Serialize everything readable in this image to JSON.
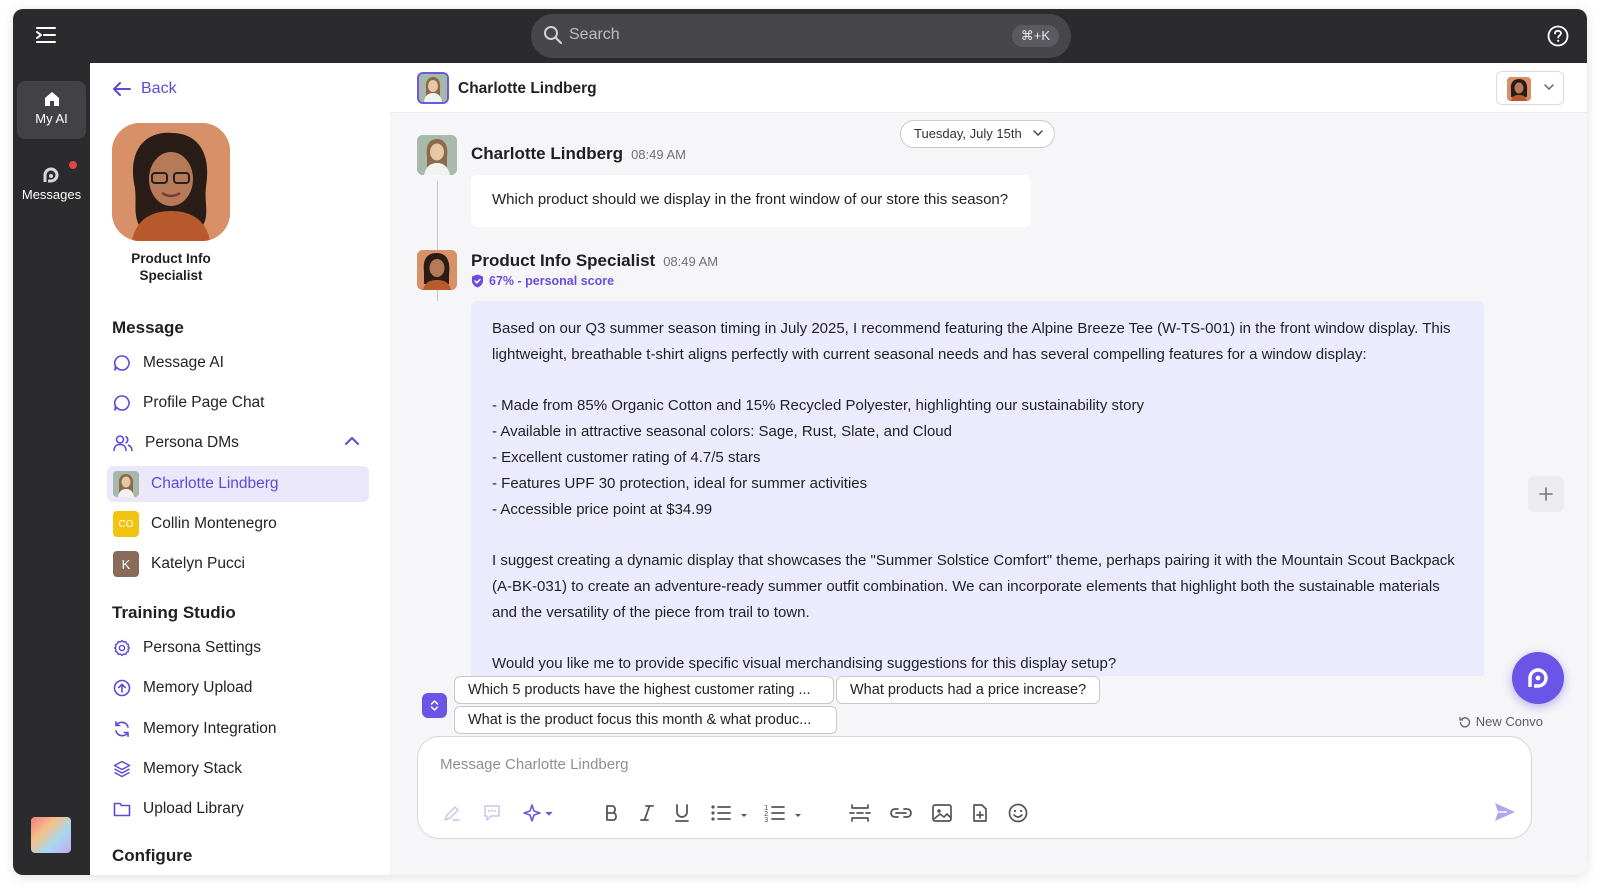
{
  "topbar": {
    "search_placeholder": "Search",
    "search_shortcut": "⌘+K"
  },
  "rail": {
    "items": [
      {
        "label": "My AI",
        "icon": "home-icon",
        "active": true
      },
      {
        "label": "Messages",
        "icon": "messages-icon",
        "has_notification": true
      }
    ]
  },
  "sidebar": {
    "back_label": "Back",
    "persona_name": "Product Info Specialist",
    "message_section": {
      "title": "Message",
      "items": [
        {
          "label": "Message AI",
          "icon": "chat-bubble-icon"
        },
        {
          "label": "Profile Page Chat",
          "icon": "chat-bubble-icon"
        },
        {
          "label": "Persona DMs",
          "icon": "users-icon",
          "expanded": true
        }
      ],
      "dms": [
        {
          "label": "Charlotte Lindberg",
          "active": true
        },
        {
          "label": "Collin Montenegro",
          "initials": "CO",
          "color": "#f2c40f"
        },
        {
          "label": "Katelyn Pucci",
          "initials": "K",
          "color": "#8a6a5a"
        }
      ]
    },
    "training_section": {
      "title": "Training Studio",
      "items": [
        {
          "label": "Persona Settings",
          "icon": "gear-icon"
        },
        {
          "label": "Memory Upload",
          "icon": "upload-circle-icon"
        },
        {
          "label": "Memory Integration",
          "icon": "refresh-icon"
        },
        {
          "label": "Memory Stack",
          "icon": "layers-icon"
        },
        {
          "label": "Upload Library",
          "icon": "folder-icon"
        }
      ]
    },
    "configure_section": {
      "title": "Configure"
    }
  },
  "chat": {
    "header_name": "Charlotte Lindberg",
    "date_label": "Tuesday, July 15th",
    "messages": [
      {
        "sender": "Charlotte Lindberg",
        "time": "08:49 AM",
        "text": "Which product should we display in the front window of our store this season?"
      },
      {
        "sender": "Product Info Specialist",
        "time": "08:49 AM",
        "score": "67% - personal score",
        "paragraphs": [
          "Based on our Q3 summer season timing in July 2025, I recommend featuring the Alpine Breeze Tee (W-TS-001) in the front window display. This lightweight, breathable t-shirt aligns perfectly with current seasonal needs and has several compelling features for a window display:",
          "- Made from 85% Organic Cotton and 15% Recycled Polyester, highlighting our sustainability story",
          "- Available in attractive seasonal colors: Sage, Rust, Slate, and Cloud",
          "- Excellent customer rating of 4.7/5 stars",
          "- Features UPF 30 protection, ideal for summer activities",
          "- Accessible price point at $34.99",
          "I suggest creating a dynamic display that showcases the \"Summer Solstice Comfort\" theme, perhaps pairing it with the Mountain Scout Backpack (A-BK-031) to create an adventure-ready summer outfit combination. We can incorporate elements that highlight both the sustainable materials and the versatility of the piece from trail to town.",
          "Would you like me to provide specific visual merchandising suggestions for this display setup?"
        ]
      }
    ],
    "suggestions": [
      "Which 5 products have the highest customer rating ...",
      "What products had a price increase?",
      "What is the product focus this month & what produc..."
    ],
    "new_convo_label": "New Convo",
    "composer_placeholder": "Message Charlotte Lindberg",
    "accent_color": "#6a55e6"
  }
}
